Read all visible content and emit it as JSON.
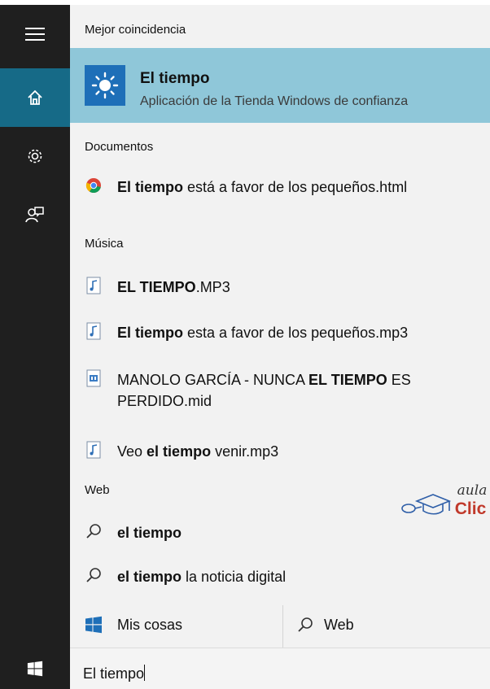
{
  "best_match": {
    "heading": "Mejor coincidencia",
    "title": "El tiempo",
    "subtitle": "Aplicación de la Tienda Windows de confianza"
  },
  "documents": {
    "heading": "Documentos",
    "items": [
      {
        "bold": "El tiempo",
        "rest": " está a favor de los pequeños.html",
        "icon": "chrome-icon"
      }
    ]
  },
  "music": {
    "heading": "Música",
    "items": [
      {
        "bold": "EL TIEMPO",
        "rest": ".MP3",
        "icon": "audio-file-icon"
      },
      {
        "bold": "El tiempo",
        "rest": " esta a favor de los pequeños.mp3",
        "icon": "audio-file-icon"
      },
      {
        "pre": "MANOLO GARCÍA - NUNCA ",
        "bold": "EL TIEMPO",
        "rest": " ES PERDIDO.mid",
        "icon": "midi-file-icon"
      },
      {
        "pre": "Veo ",
        "bold": "el tiempo",
        "rest": " venir.mp3",
        "icon": "audio-file-icon"
      }
    ]
  },
  "web": {
    "heading": "Web",
    "items": [
      {
        "bold": "el tiempo",
        "rest": "",
        "icon": "search-icon"
      },
      {
        "bold": "el tiempo",
        "rest": " la noticia digital",
        "icon": "search-icon"
      }
    ]
  },
  "tabs": {
    "my_stuff": "Mis cosas",
    "web": "Web"
  },
  "search": {
    "value": "El tiempo"
  },
  "logo": {
    "line1": "aula",
    "line2": "Clic"
  },
  "colors": {
    "sidebar": "#1f1f1f",
    "active": "#166a87",
    "highlight": "#8fc7d9",
    "panel": "#f2f2f2",
    "logo_red": "#c0392b"
  }
}
